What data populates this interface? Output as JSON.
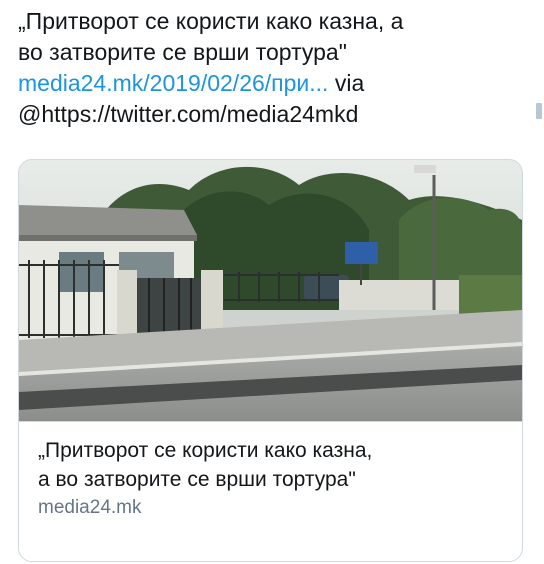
{
  "tweet": {
    "text_line1": "„Притворот се користи како казна, а",
    "text_line2": "во затворите се врши тортура\"",
    "link": "media24.mk/2019/02/26/при...",
    "via": " via",
    "handle_text": "@https://twitter.com/media24mkd"
  },
  "card": {
    "image_icon": "photo-of-prison-entrance",
    "title_line1": "„Притворот се користи како казна,",
    "title_line2": "а во затворите се врши тортура\"",
    "domain": "media24.mk"
  },
  "colors": {
    "link": "#1b95e0",
    "text": "#14171a",
    "secondary": "#657786",
    "border": "#cfd9de"
  }
}
